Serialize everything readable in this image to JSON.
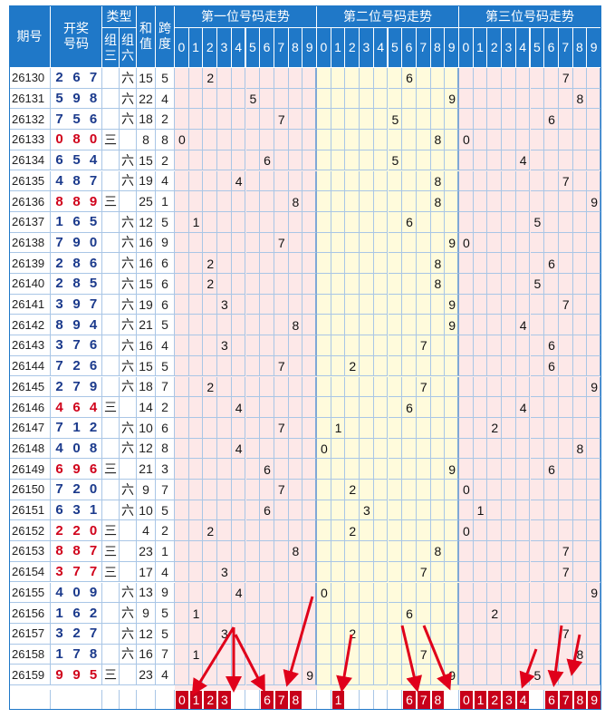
{
  "header": {
    "issue": "期号",
    "draw": "开奖\n号码",
    "type": "类型",
    "type_g3": "组\n三",
    "type_g6": "组\n六",
    "sum": "和\n值",
    "span": "跨\n度",
    "zone1": "第一位号码走势",
    "zone2": "第二位号码走势",
    "zone3": "第三位号码走势",
    "digits": [
      "0",
      "1",
      "2",
      "3",
      "4",
      "5",
      "6",
      "7",
      "8",
      "9"
    ]
  },
  "type_labels": {
    "g3": "三",
    "g6": "六"
  },
  "colors": {
    "header_blue": "#1f78c8",
    "zone1_bg": "#fde8e8",
    "zone2_bg": "#fffbdc",
    "zone3_bg": "#fde8e8",
    "grid": "#a9c6e6",
    "number_blue": "#1b3a8c",
    "number_red": "#d0021b",
    "badge_red": "#c8001a",
    "arrow_red": "#e0001a"
  },
  "chart_data": {
    "type": "table",
    "columns": [
      "期号",
      "开奖号码",
      "类型",
      "和值",
      "跨度",
      "第一位",
      "第二位",
      "第三位"
    ],
    "rows": [
      {
        "issue": "26130",
        "n": [
          2,
          6,
          7
        ],
        "type": "g6",
        "sum": 15,
        "span": 5
      },
      {
        "issue": "26131",
        "n": [
          5,
          9,
          8
        ],
        "type": "g6",
        "sum": 22,
        "span": 4
      },
      {
        "issue": "26132",
        "n": [
          7,
          5,
          6
        ],
        "type": "g6",
        "sum": 18,
        "span": 2
      },
      {
        "issue": "26133",
        "n": [
          0,
          8,
          0
        ],
        "type": "g3",
        "sum": 8,
        "span": 8
      },
      {
        "issue": "26134",
        "n": [
          6,
          5,
          4
        ],
        "type": "g6",
        "sum": 15,
        "span": 2
      },
      {
        "issue": "26135",
        "n": [
          4,
          8,
          7
        ],
        "type": "g6",
        "sum": 19,
        "span": 4
      },
      {
        "issue": "26136",
        "n": [
          8,
          8,
          9
        ],
        "type": "g3",
        "sum": 25,
        "span": 1
      },
      {
        "issue": "26137",
        "n": [
          1,
          6,
          5
        ],
        "type": "g6",
        "sum": 12,
        "span": 5
      },
      {
        "issue": "26138",
        "n": [
          7,
          9,
          0
        ],
        "type": "g6",
        "sum": 16,
        "span": 9
      },
      {
        "issue": "26139",
        "n": [
          2,
          8,
          6
        ],
        "type": "g6",
        "sum": 16,
        "span": 6
      },
      {
        "issue": "26140",
        "n": [
          2,
          8,
          5
        ],
        "type": "g6",
        "sum": 15,
        "span": 6
      },
      {
        "issue": "26141",
        "n": [
          3,
          9,
          7
        ],
        "type": "g6",
        "sum": 19,
        "span": 6
      },
      {
        "issue": "26142",
        "n": [
          8,
          9,
          4
        ],
        "type": "g6",
        "sum": 21,
        "span": 5
      },
      {
        "issue": "26143",
        "n": [
          3,
          7,
          6
        ],
        "type": "g6",
        "sum": 16,
        "span": 4
      },
      {
        "issue": "26144",
        "n": [
          7,
          2,
          6
        ],
        "type": "g6",
        "sum": 15,
        "span": 5
      },
      {
        "issue": "26145",
        "n": [
          2,
          7,
          9
        ],
        "type": "g6",
        "sum": 18,
        "span": 7
      },
      {
        "issue": "26146",
        "n": [
          4,
          6,
          4
        ],
        "type": "g3",
        "sum": 14,
        "span": 2
      },
      {
        "issue": "26147",
        "n": [
          7,
          1,
          2
        ],
        "type": "g6",
        "sum": 10,
        "span": 6
      },
      {
        "issue": "26148",
        "n": [
          4,
          0,
          8
        ],
        "type": "g6",
        "sum": 12,
        "span": 8
      },
      {
        "issue": "26149",
        "n": [
          6,
          9,
          6
        ],
        "type": "g3",
        "sum": 21,
        "span": 3
      },
      {
        "issue": "26150",
        "n": [
          7,
          2,
          0
        ],
        "type": "g6",
        "sum": 9,
        "span": 7
      },
      {
        "issue": "26151",
        "n": [
          6,
          3,
          1
        ],
        "type": "g6",
        "sum": 10,
        "span": 5
      },
      {
        "issue": "26152",
        "n": [
          2,
          2,
          0
        ],
        "type": "g3",
        "sum": 4,
        "span": 2
      },
      {
        "issue": "26153",
        "n": [
          8,
          8,
          7
        ],
        "type": "g3",
        "sum": 23,
        "span": 1
      },
      {
        "issue": "26154",
        "n": [
          3,
          7,
          7
        ],
        "type": "g3",
        "sum": 17,
        "span": 4
      },
      {
        "issue": "26155",
        "n": [
          4,
          0,
          9
        ],
        "type": "g6",
        "sum": 13,
        "span": 9
      },
      {
        "issue": "26156",
        "n": [
          1,
          6,
          2
        ],
        "type": "g6",
        "sum": 9,
        "span": 5
      },
      {
        "issue": "26157",
        "n": [
          3,
          2,
          7
        ],
        "type": "g6",
        "sum": 12,
        "span": 5
      },
      {
        "issue": "26158",
        "n": [
          1,
          7,
          8
        ],
        "type": "g6",
        "sum": 16,
        "span": 7
      },
      {
        "issue": "26159",
        "n": [
          9,
          9,
          5
        ],
        "type": "g3",
        "sum": 23,
        "span": 4
      }
    ],
    "picks": {
      "pos1": [
        0,
        1,
        2,
        3,
        6,
        7,
        8
      ],
      "pos2": [
        1,
        6,
        7,
        8
      ],
      "pos3": [
        0,
        1,
        2,
        3,
        4,
        6,
        7,
        8,
        9
      ]
    }
  }
}
